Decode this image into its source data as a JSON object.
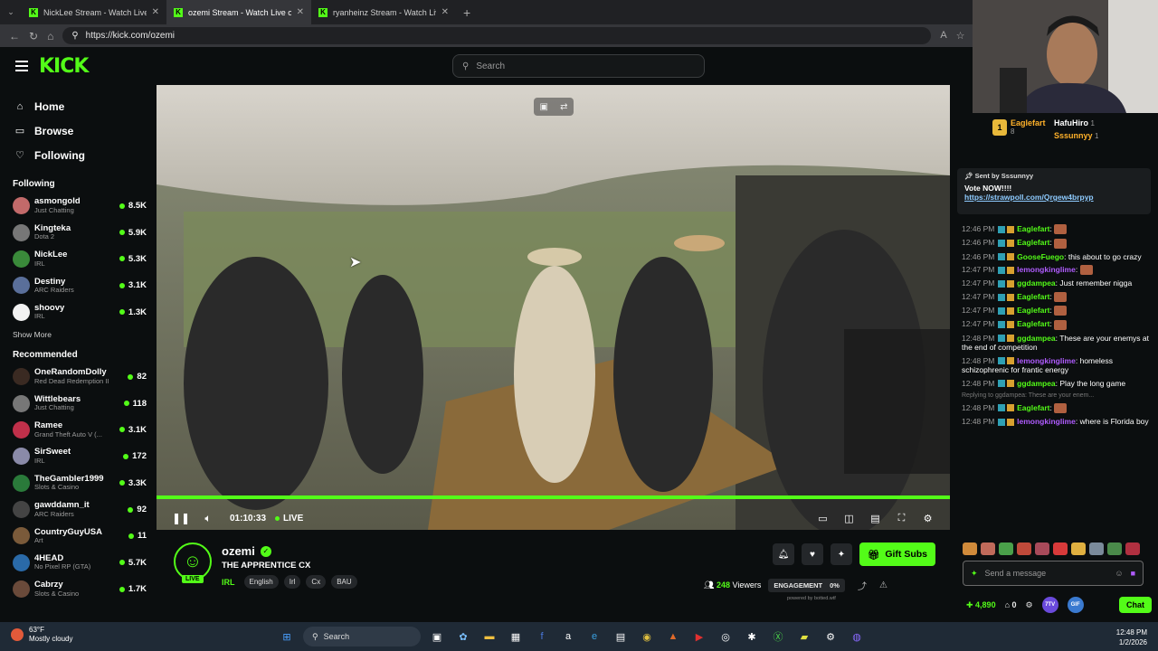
{
  "browser": {
    "tabs": [
      {
        "title": "NickLee Stream - Watch Live on Kick",
        "active": false
      },
      {
        "title": "ozemi Stream - Watch Live on Kick",
        "active": true
      },
      {
        "title": "ryanheinz Stream - Watch Live on Kick",
        "active": false
      }
    ],
    "url": "https://kick.com/ozemi"
  },
  "header": {
    "logo": "KICK",
    "search_placeholder": "Search"
  },
  "sidebar": {
    "nav": [
      {
        "label": "Home",
        "icon": "home-icon"
      },
      {
        "label": "Browse",
        "icon": "browse-icon"
      },
      {
        "label": "Following",
        "icon": "heart-icon"
      }
    ],
    "following_title": "Following",
    "following": [
      {
        "name": "asmongold",
        "category": "Just Chatting",
        "viewers": "8.5K",
        "color": "#c26a6a"
      },
      {
        "name": "Kingteka",
        "category": "Dota 2",
        "viewers": "5.9K",
        "color": "#777777"
      },
      {
        "name": "NickLee",
        "category": "IRL",
        "viewers": "5.3K",
        "color": "#3a8a3a"
      },
      {
        "name": "Destiny",
        "category": "ARC Raiders",
        "viewers": "3.1K",
        "color": "#5a6f9a"
      },
      {
        "name": "shoovy",
        "category": "IRL",
        "viewers": "1.3K",
        "color": "#f2f2f2"
      }
    ],
    "show_more": "Show More",
    "recommended_title": "Recommended",
    "recommended": [
      {
        "name": "OneRandomDolly",
        "category": "Red Dead Redemption II",
        "viewers": "82",
        "color": "#3a2a22"
      },
      {
        "name": "Wittlebears",
        "category": "Just Chatting",
        "viewers": "118",
        "color": "#777777"
      },
      {
        "name": "Ramee",
        "category": "Grand Theft Auto V (...",
        "viewers": "3.1K",
        "color": "#c0304a"
      },
      {
        "name": "SirSweet",
        "category": "IRL",
        "viewers": "172",
        "color": "#8a8aa8"
      },
      {
        "name": "TheGambler1999",
        "category": "Slots & Casino",
        "viewers": "3.3K",
        "color": "#2a7a3a"
      },
      {
        "name": "gawddamn_it",
        "category": "ARC Raiders",
        "viewers": "92",
        "color": "#444444"
      },
      {
        "name": "CountryGuyUSA",
        "category": "Art",
        "viewers": "11",
        "color": "#7a5a3a"
      },
      {
        "name": "4HEAD",
        "category": "No Pixel RP (GTA)",
        "viewers": "5.7K",
        "color": "#2a6aa8"
      },
      {
        "name": "Cabrzy",
        "category": "Slots & Casino",
        "viewers": "1.7K",
        "color": "#6a4a3a"
      }
    ]
  },
  "player": {
    "time": "01:10:33",
    "live_label": "LIVE",
    "progress": 1.0
  },
  "stream": {
    "streamer": "ozemi",
    "live_badge": "LIVE",
    "title": "THE APPRENTICE CX",
    "category": "IRL",
    "tags": [
      "English",
      "Irl",
      "Cx",
      "BAU"
    ],
    "gift_label": "Gift Subs",
    "viewers": "248",
    "viewers_label": "Viewers",
    "engagement_label": "ENGAGEMENT",
    "engagement_value": "0%",
    "powered": "powered by botted.wtf"
  },
  "chat": {
    "leaderboard": [
      {
        "name": "Eaglefart",
        "count": "8",
        "rank": "1"
      },
      {
        "name": "HafuHiro",
        "count": "1"
      },
      {
        "name": "Sssunnyy",
        "count": "1"
      }
    ],
    "pinned": {
      "sent_by_label": "Sent by",
      "sender": "Sssunnyy",
      "text": "Vote NOW!!!!",
      "link": "https://strawpoll.com/Qrgew4brpyp"
    },
    "messages": [
      {
        "ts": "12:46 PM",
        "user": "Eaglefart",
        "color": "#53fc18",
        "text": "",
        "emote": true
      },
      {
        "ts": "12:46 PM",
        "user": "Eaglefart",
        "color": "#53fc18",
        "text": "",
        "emote": true
      },
      {
        "ts": "12:46 PM",
        "user": "GooseFuego",
        "color": "#53fc18",
        "text": "this about to go crazy",
        "emote": false
      },
      {
        "ts": "12:47 PM",
        "user": "lemongkinglime",
        "color": "#b05cff",
        "text": "",
        "emote": true
      },
      {
        "ts": "12:47 PM",
        "user": "ggdampea",
        "color": "#53fc18",
        "text": "Just remember nigga",
        "emote": false
      },
      {
        "ts": "12:47 PM",
        "user": "Eaglefart",
        "color": "#53fc18",
        "text": "",
        "emote": true
      },
      {
        "ts": "12:47 PM",
        "user": "Eaglefart",
        "color": "#53fc18",
        "text": "",
        "emote": true
      },
      {
        "ts": "12:47 PM",
        "user": "Eaglefart",
        "color": "#53fc18",
        "text": "",
        "emote": true
      },
      {
        "ts": "12:48 PM",
        "user": "ggdampea",
        "color": "#53fc18",
        "text": "These are your enemys at the end of competition",
        "emote": false
      },
      {
        "ts": "12:48 PM",
        "user": "lemongkinglime",
        "color": "#b05cff",
        "text": "homeless schizophrenic for frantic energy",
        "emote": false
      },
      {
        "ts": "12:48 PM",
        "user": "ggdampea",
        "color": "#53fc18",
        "text": "Play the long game",
        "emote": false
      }
    ],
    "reply_preview": "Replying to ggdampea: These are your enem...",
    "messages2": [
      {
        "ts": "12:48 PM",
        "user": "Eaglefart",
        "color": "#53fc18",
        "text": "",
        "emote": true
      },
      {
        "ts": "12:48 PM",
        "user": "lemongkinglime",
        "color": "#b05cff",
        "text": "where is Florida boy",
        "emote": false
      }
    ],
    "input_placeholder": "Send a message",
    "points": "4,890",
    "zero": "0",
    "chat_button": "Chat"
  },
  "taskbar": {
    "temp": "63°F",
    "weather": "Mostly cloudy",
    "search_label": "Search",
    "time": "12:48 PM",
    "date": "1/2/2026"
  }
}
